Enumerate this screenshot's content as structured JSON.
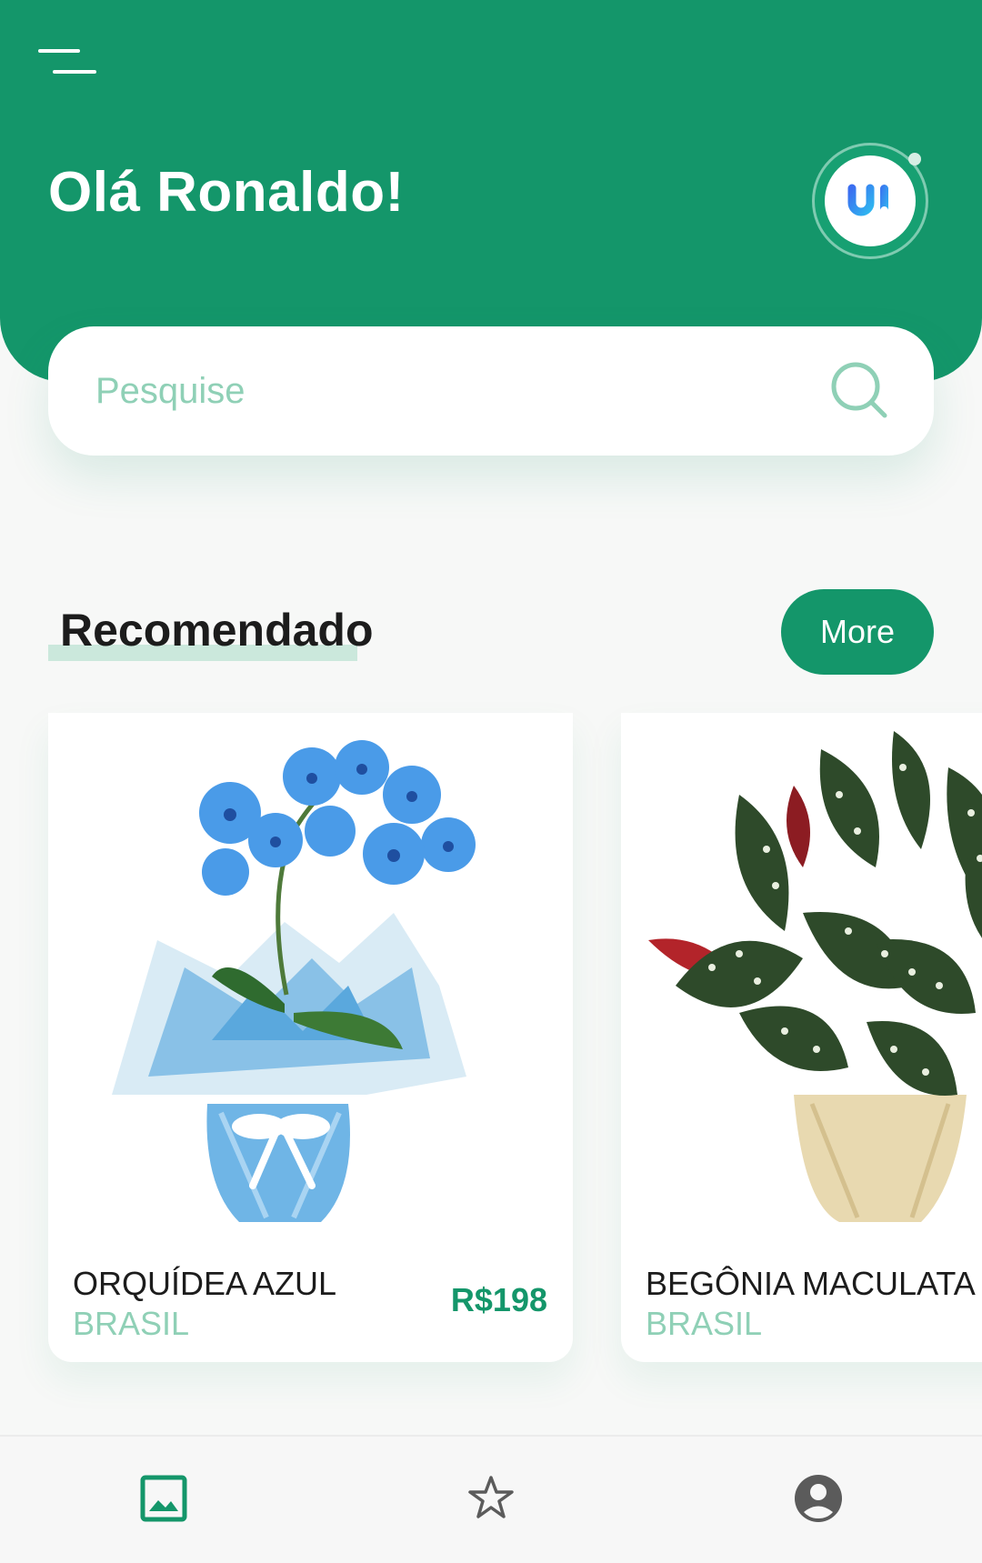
{
  "header": {
    "greeting": "Olá Ronaldo!",
    "avatar_icon": "ui-logo",
    "avatar_status_color": "#d6eee4"
  },
  "search": {
    "placeholder": "Pesquise",
    "value": ""
  },
  "recommended": {
    "title": "Recomendado",
    "more_label": "More",
    "items": [
      {
        "name": "ORQUÍDEA AZUL",
        "origin": "BRASIL",
        "price": "R$198",
        "image": "blue-orchid-photo"
      },
      {
        "name": "BEGÔNIA MACULATA",
        "origin": "BRASIL",
        "price": "",
        "image": "begonia-maculata-photo"
      }
    ]
  },
  "bottom_nav": {
    "items": [
      {
        "icon": "image-icon",
        "active": true
      },
      {
        "icon": "star-icon",
        "active": false
      },
      {
        "icon": "account-icon",
        "active": false
      }
    ]
  },
  "colors": {
    "primary": "#14966a",
    "accent_light": "#8fd0b6",
    "background": "#f7f8f7",
    "text_dark": "#1c1c1c",
    "icon_inactive": "#5b5b5b"
  }
}
